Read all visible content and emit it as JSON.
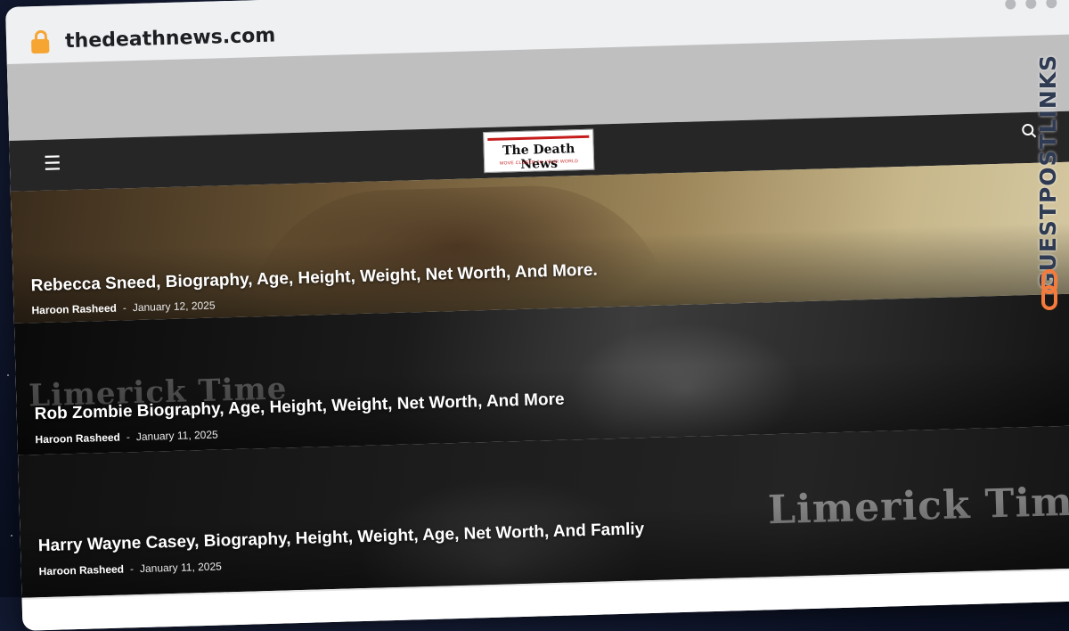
{
  "browser": {
    "url": "thedeathnews.com"
  },
  "site": {
    "logo_title": "The Death News",
    "logo_tagline": "MOVE CLOSER TO YOUR WORLD",
    "menu_icon": "menu-icon",
    "search_icon": "search-icon"
  },
  "badge": {
    "part1": "GUESTPOST",
    "part2": "LINKS",
    "icon": "link-chain-icon",
    "accent": "#f47b3b"
  },
  "watermark_text": "Limerick Time",
  "posts": [
    {
      "title": "Rebecca Sneed, Biography, Age, Height, Weight, Net Worth, And More.",
      "author": "Haroon Rasheed",
      "separator": "-",
      "date": "January 12, 2025"
    },
    {
      "title": "Rob Zombie Biography, Age, Height, Weight, Net Worth, And More",
      "author": "Haroon Rasheed",
      "separator": "-",
      "date": "January 11, 2025"
    },
    {
      "title": "Harry Wayne Casey, Biography, Height, Weight, Age, Net Worth, And Famliy",
      "author": "Haroon Rasheed",
      "separator": "-",
      "date": "January 11, 2025"
    }
  ],
  "colors": {
    "header_bg": "#262626",
    "ad_band": "#bfbfbf",
    "lock": "#f6a533",
    "logo_red": "#c61c1c"
  }
}
